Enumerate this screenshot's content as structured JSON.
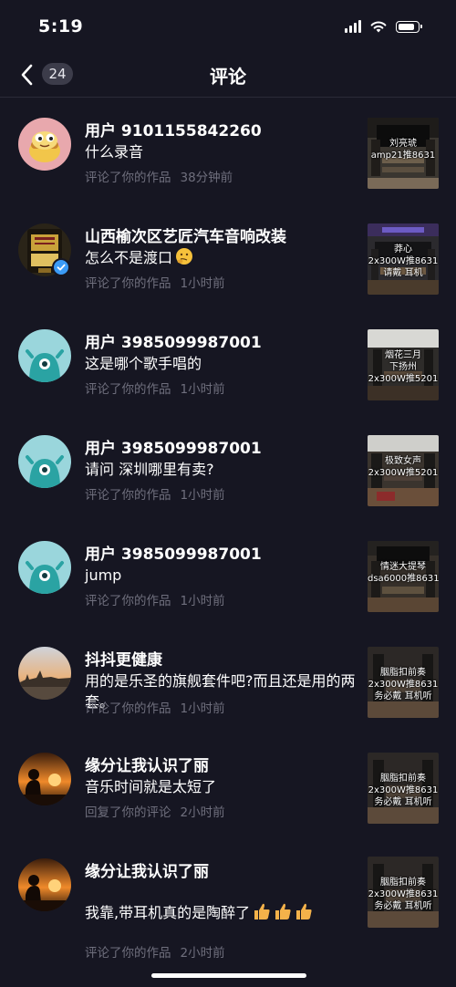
{
  "status_bar": {
    "time": "5:19"
  },
  "header": {
    "back_label": "back",
    "count": "24",
    "title": "评论"
  },
  "comments": [
    {
      "name": "用户 9101155842260",
      "text": "什么录音",
      "action": "评论了你的作品",
      "time": "38分钟前",
      "avatar": "cartoon-food-avatar",
      "thumb_caption": [
        "刘亮琥",
        "amp21推8631"
      ]
    },
    {
      "name": "山西榆次区艺匠汽车音响改装",
      "text": "怎么不是渡口",
      "emoji": "thinking-face",
      "action": "评论了你的作品",
      "time": "1小时前",
      "verified": true,
      "avatar": "trophy-avatar",
      "thumb_caption": [
        "莽心",
        "2x300W推8631",
        "请戴    耳机"
      ]
    },
    {
      "name": "用户 3985099987001",
      "text": "这是哪个歌手唱的",
      "action": "评论了你的作品",
      "time": "1小时前",
      "avatar": "default-teal-avatar",
      "thumb_caption": [
        "烟花三月",
        "下扬州",
        "2x300W推5201"
      ]
    },
    {
      "name": "用户 3985099987001",
      "text": "请问 深圳哪里有卖?",
      "action": "评论了你的作品",
      "time": "1小时前",
      "avatar": "default-teal-avatar",
      "thumb_caption": [
        "极致女声",
        "2x300W推5201"
      ]
    },
    {
      "name": "用户 3985099987001",
      "text": "jump",
      "action": "评论了你的作品",
      "time": "1小时前",
      "avatar": "default-teal-avatar",
      "thumb_caption": [
        "情迷大提琴",
        "dsa6000推8631"
      ]
    },
    {
      "name": "抖抖更健康",
      "text": "用的是乐圣的旗舰套件吧?而且还是用的两套。",
      "action": "评论了你的作品",
      "time": "1小时前",
      "avatar": "landscape-avatar",
      "thumb_caption": [
        "胭脂扣前奏",
        "2x300W推8631",
        "务必戴  耳机听"
      ]
    },
    {
      "name": "缘分让我认识了丽",
      "text": "音乐时间就是太短了",
      "action": "回复了你的评论",
      "time": "2小时前",
      "avatar": "sunset-silhouette-avatar",
      "thumb_caption": [
        "胭脂扣前奏",
        "2x300W推8631",
        "务必戴  耳机听"
      ]
    },
    {
      "name": "缘分让我认识了丽",
      "text": "我靠,带耳机真的是陶醉了",
      "emoji": "thumbs-up x3",
      "action": "评论了你的作品",
      "time": "2小时前",
      "avatar": "sunset-silhouette-avatar",
      "thumb_caption": [
        "胭脂扣前奏",
        "2x300W推8631",
        "务必戴  耳机听"
      ]
    }
  ]
}
